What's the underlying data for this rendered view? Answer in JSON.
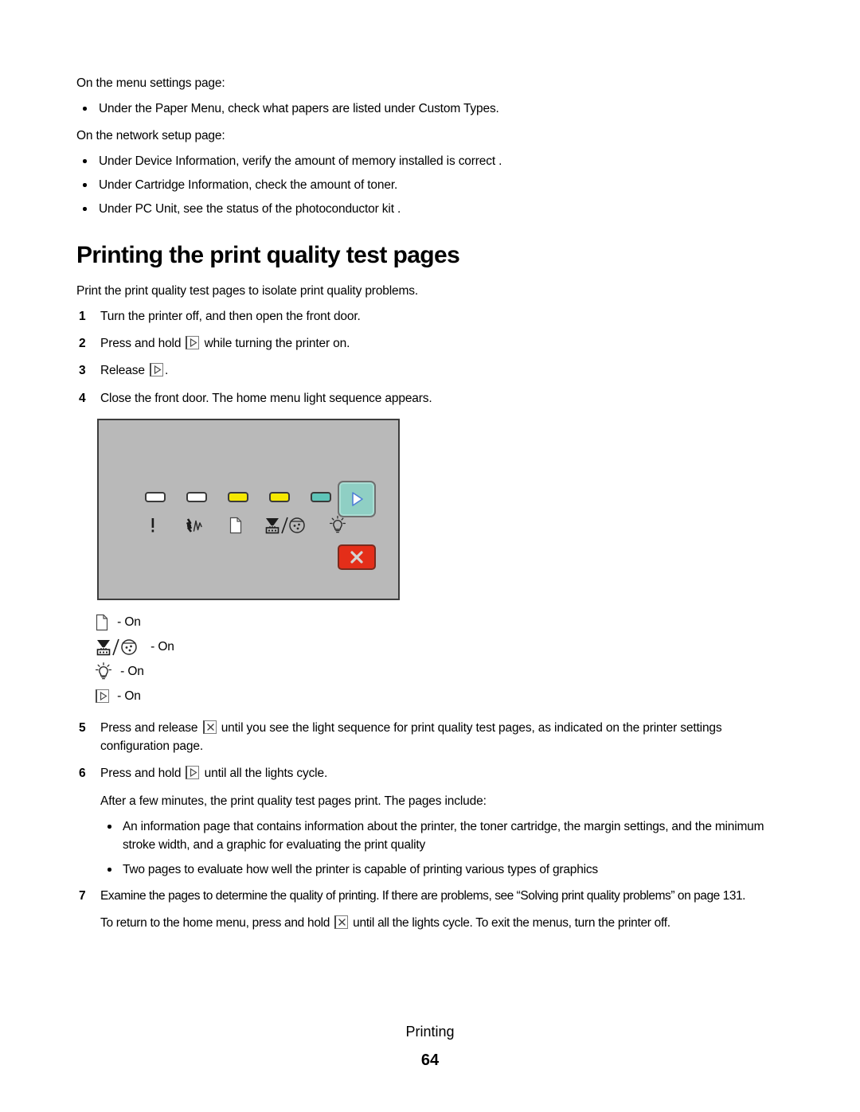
{
  "document": {
    "intro_blocks": [
      {
        "lead": "On the menu settings page:",
        "bullets": [
          "Under the Paper Menu, check what papers are listed under Custom Types."
        ]
      },
      {
        "lead": "On the network setup page:",
        "bullets": [
          "Under Device Information, verify the amount of memory installed is correct .",
          "Under Cartridge Information, check the amount of toner.",
          "Under PC Unit, see the status of the photoconductor kit ."
        ]
      }
    ],
    "section": {
      "title": "Printing the print quality test pages",
      "intro": "Print the print quality test pages to isolate print quality problems.",
      "steps": [
        {
          "number": "1",
          "text_before": "Turn the printer off, and then open the front door.",
          "icon": "",
          "text_after": ""
        },
        {
          "number": "2",
          "text_before": "Press and hold ",
          "icon": "continue-arrow-key-icon",
          "text_after": " while turning the printer on."
        },
        {
          "number": "3",
          "text_before": "Release ",
          "icon": "continue-arrow-key-icon",
          "text_after": "."
        },
        {
          "number": "4",
          "text_before": "Close the front door. The home menu light sequence appears.",
          "icon": "",
          "text_after": ""
        }
      ],
      "steps_after_figure": [
        {
          "number": "5",
          "text_before": "Press and release ",
          "icon": "stop-x-key-icon",
          "text_after": " until you see the light sequence for print quality test pages, as indicated on the printer settings configuration page."
        },
        {
          "number": "6",
          "text_before": "Press and hold ",
          "icon": "continue-arrow-key-icon",
          "text_after": " until all the lights cycle."
        }
      ],
      "step6_note": "After a few minutes, the print quality test pages print. The pages include:",
      "step6_bullets": [
        "An information page that contains information about the printer, the toner cartridge, the margin settings, and the minimum stroke width, and a graphic for evaluating the print quality",
        "Two pages to evaluate how well the printer is capable of printing various types of graphics"
      ],
      "step7": {
        "number": "7",
        "text": "Examine the pages to determine the quality of printing. If there are problems, see “Solving print quality problems” on page 131."
      },
      "closing_note": {
        "text_before": "To return to the home menu, press and hold ",
        "icon": "stop-x-key-icon",
        "text_after": " until all the lights cycle. To exit the menus, turn the printer off."
      }
    },
    "control_panel": {
      "leds": [
        {
          "name": "error-led",
          "state": "off",
          "color": "#ffffff"
        },
        {
          "name": "paper-jam-led",
          "state": "off",
          "color": "#ffffff"
        },
        {
          "name": "load-paper-led",
          "state": "on",
          "color": "#f5e800"
        },
        {
          "name": "toner-pc-unit-led",
          "state": "on",
          "color": "#f5e800"
        },
        {
          "name": "ready-led",
          "state": "on",
          "color": "#5ec4b8"
        }
      ],
      "symbols": [
        "error-exclamation-icon",
        "paper-jam-icon",
        "load-paper-icon",
        "toner-pc-unit-icon",
        "ready-lightbulb-icon"
      ],
      "buttons": [
        {
          "name": "continue-button",
          "color": "#8fcfc4",
          "glyph": "triangle-right"
        },
        {
          "name": "stop-button",
          "color": "#e42e19",
          "glyph": "x-mark"
        }
      ],
      "panel_color": "#b9b9b9"
    },
    "legend": [
      {
        "icon": "load-paper-icon",
        "label": " - On"
      },
      {
        "icon": "toner-pc-unit-icon",
        "label": " - On"
      },
      {
        "icon": "ready-lightbulb-icon",
        "label": " - On"
      },
      {
        "icon": "continue-arrow-key-icon",
        "label": " - On"
      }
    ],
    "footer": {
      "title": "Printing",
      "page_number": "64"
    }
  }
}
